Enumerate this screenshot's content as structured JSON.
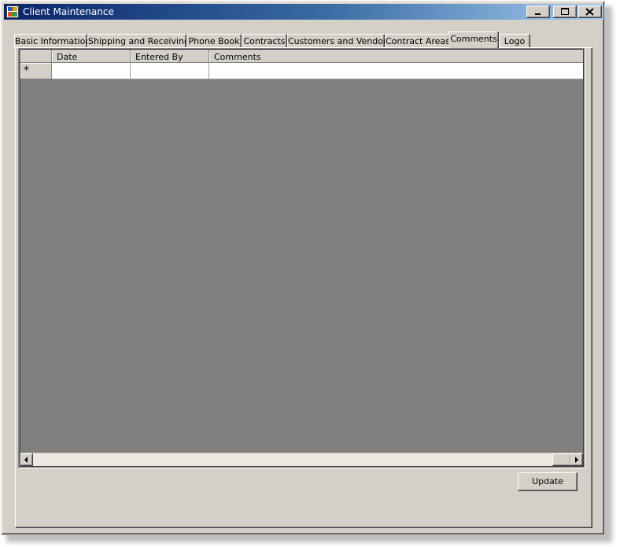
{
  "window": {
    "title": "Client Maintenance",
    "controls": {
      "minimize": "minimize",
      "maximize": "maximize",
      "close": "close"
    }
  },
  "tabs": [
    {
      "label": "Basic Information",
      "active": false
    },
    {
      "label": "Shipping and Receiving",
      "active": false
    },
    {
      "label": "Phone Book",
      "active": false
    },
    {
      "label": "Contracts",
      "active": false
    },
    {
      "label": "Customers and Vendors",
      "active": false
    },
    {
      "label": "Contract Areas",
      "active": false
    },
    {
      "label": "Comments",
      "active": true
    },
    {
      "label": "Logo",
      "active": false
    }
  ],
  "grid": {
    "columns": [
      "Date",
      "Entered By",
      "Comments"
    ],
    "new_row_marker": "*",
    "rows": [
      {
        "Date": "",
        "Entered By": "",
        "Comments": ""
      }
    ]
  },
  "buttons": {
    "update": "Update"
  },
  "icons": {
    "app": "app-window-icon",
    "minimize": "minimize-icon",
    "maximize": "maximize-icon",
    "close": "close-icon",
    "scroll_left": "arrow-left-icon",
    "scroll_right": "arrow-right-icon"
  },
  "colors": {
    "title_start": "#0a246a",
    "title_end": "#a6caf0",
    "face": "#d4d0c8",
    "grid_bg": "#808080"
  }
}
